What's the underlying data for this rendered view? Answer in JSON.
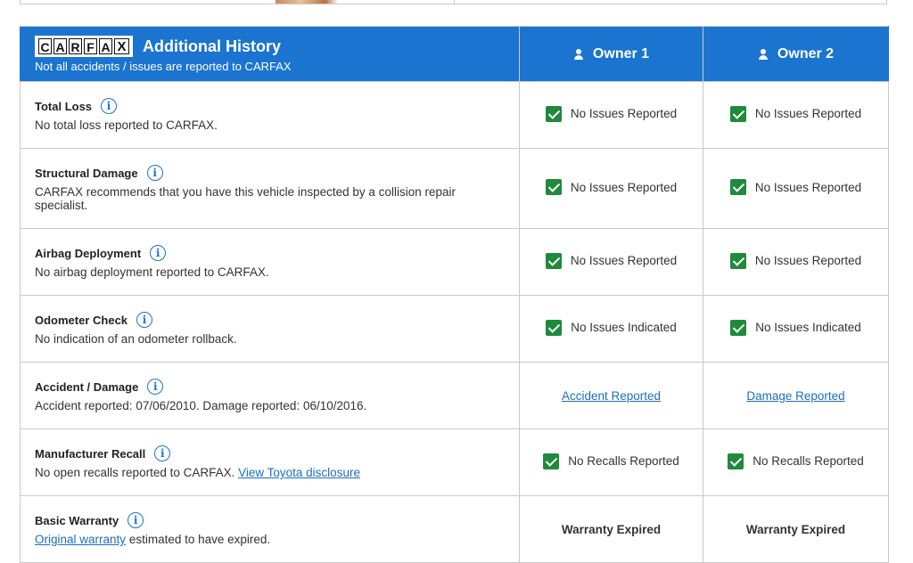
{
  "header": {
    "logo_letters": [
      "C",
      "A",
      "R",
      "F",
      "A",
      "X"
    ],
    "title": "Additional History",
    "subtitle": "Not all accidents / issues are reported to CARFAX",
    "owners": [
      "Owner 1",
      "Owner 2"
    ]
  },
  "colors": {
    "header_blue": "#1b74d0",
    "check_green": "#1f8a3b",
    "link_blue": "#1b6fc0"
  },
  "rows": [
    {
      "title": "Total Loss",
      "desc": "No total loss reported to CARFAX.",
      "owner1": "No Issues Reported",
      "owner2": "No Issues Reported",
      "status_type": "check"
    },
    {
      "title": "Structural Damage",
      "desc": "CARFAX recommends that you have this vehicle inspected by a collision repair specialist.",
      "owner1": "No Issues Reported",
      "owner2": "No Issues Reported",
      "status_type": "check"
    },
    {
      "title": "Airbag Deployment",
      "desc": "No airbag deployment reported to CARFAX.",
      "owner1": "No Issues Reported",
      "owner2": "No Issues Reported",
      "status_type": "check"
    },
    {
      "title": "Odometer Check",
      "desc": "No indication of an odometer rollback.",
      "owner1": "No Issues Indicated",
      "owner2": "No Issues Indicated",
      "status_type": "check"
    },
    {
      "title": "Accident / Damage",
      "desc": "Accident reported: 07/06/2010. Damage reported: 06/10/2016.",
      "owner1": "Accident Reported",
      "owner2": "Damage Reported",
      "status_type": "link"
    },
    {
      "title": "Manufacturer Recall",
      "desc": "No open recalls reported to CARFAX.",
      "desc_link": "View Toyota disclosure",
      "owner1": "No Recalls Reported",
      "owner2": "No Recalls Reported",
      "status_type": "check"
    },
    {
      "title": "Basic Warranty",
      "desc_link_prefix": "Original warranty",
      "desc": "estimated to have expired.",
      "owner1": "Warranty Expired",
      "owner2": "Warranty Expired",
      "status_type": "bold"
    }
  ]
}
